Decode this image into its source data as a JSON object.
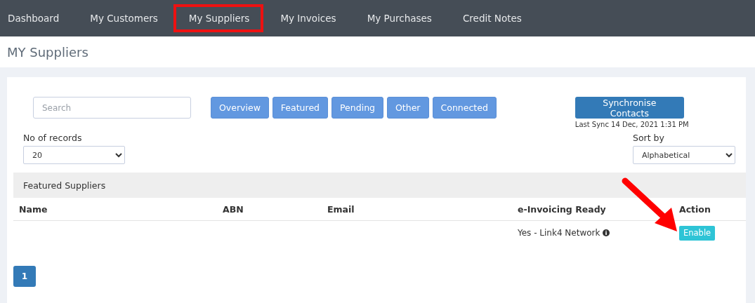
{
  "nav": {
    "items": [
      {
        "label": "Dashboard",
        "highlighted": false
      },
      {
        "label": "My Customers",
        "highlighted": false
      },
      {
        "label": "My Suppliers",
        "highlighted": true
      },
      {
        "label": "My Invoices",
        "highlighted": false
      },
      {
        "label": "My Purchases",
        "highlighted": false
      },
      {
        "label": "Credit Notes",
        "highlighted": false
      }
    ]
  },
  "page_title": "MY Suppliers",
  "search": {
    "placeholder": "Search"
  },
  "filters": [
    "Overview",
    "Featured",
    "Pending",
    "Other",
    "Connected"
  ],
  "sync": {
    "button": "Synchronise Contacts",
    "last_sync": "Last Sync 14 Dec, 2021 1:31 PM"
  },
  "records": {
    "label": "No of records",
    "value": "20"
  },
  "sort": {
    "label": "Sort by",
    "value": "Alphabetical"
  },
  "section_title": "Featured Suppliers",
  "table": {
    "columns": [
      "Name",
      "ABN",
      "Email",
      "e-Invoicing Ready",
      "Action"
    ],
    "rows": [
      {
        "einvoicing": "Yes - Link4 Network",
        "action": "Enable"
      }
    ]
  },
  "pagination": [
    "1"
  ],
  "annotation": {
    "arrow": true
  }
}
